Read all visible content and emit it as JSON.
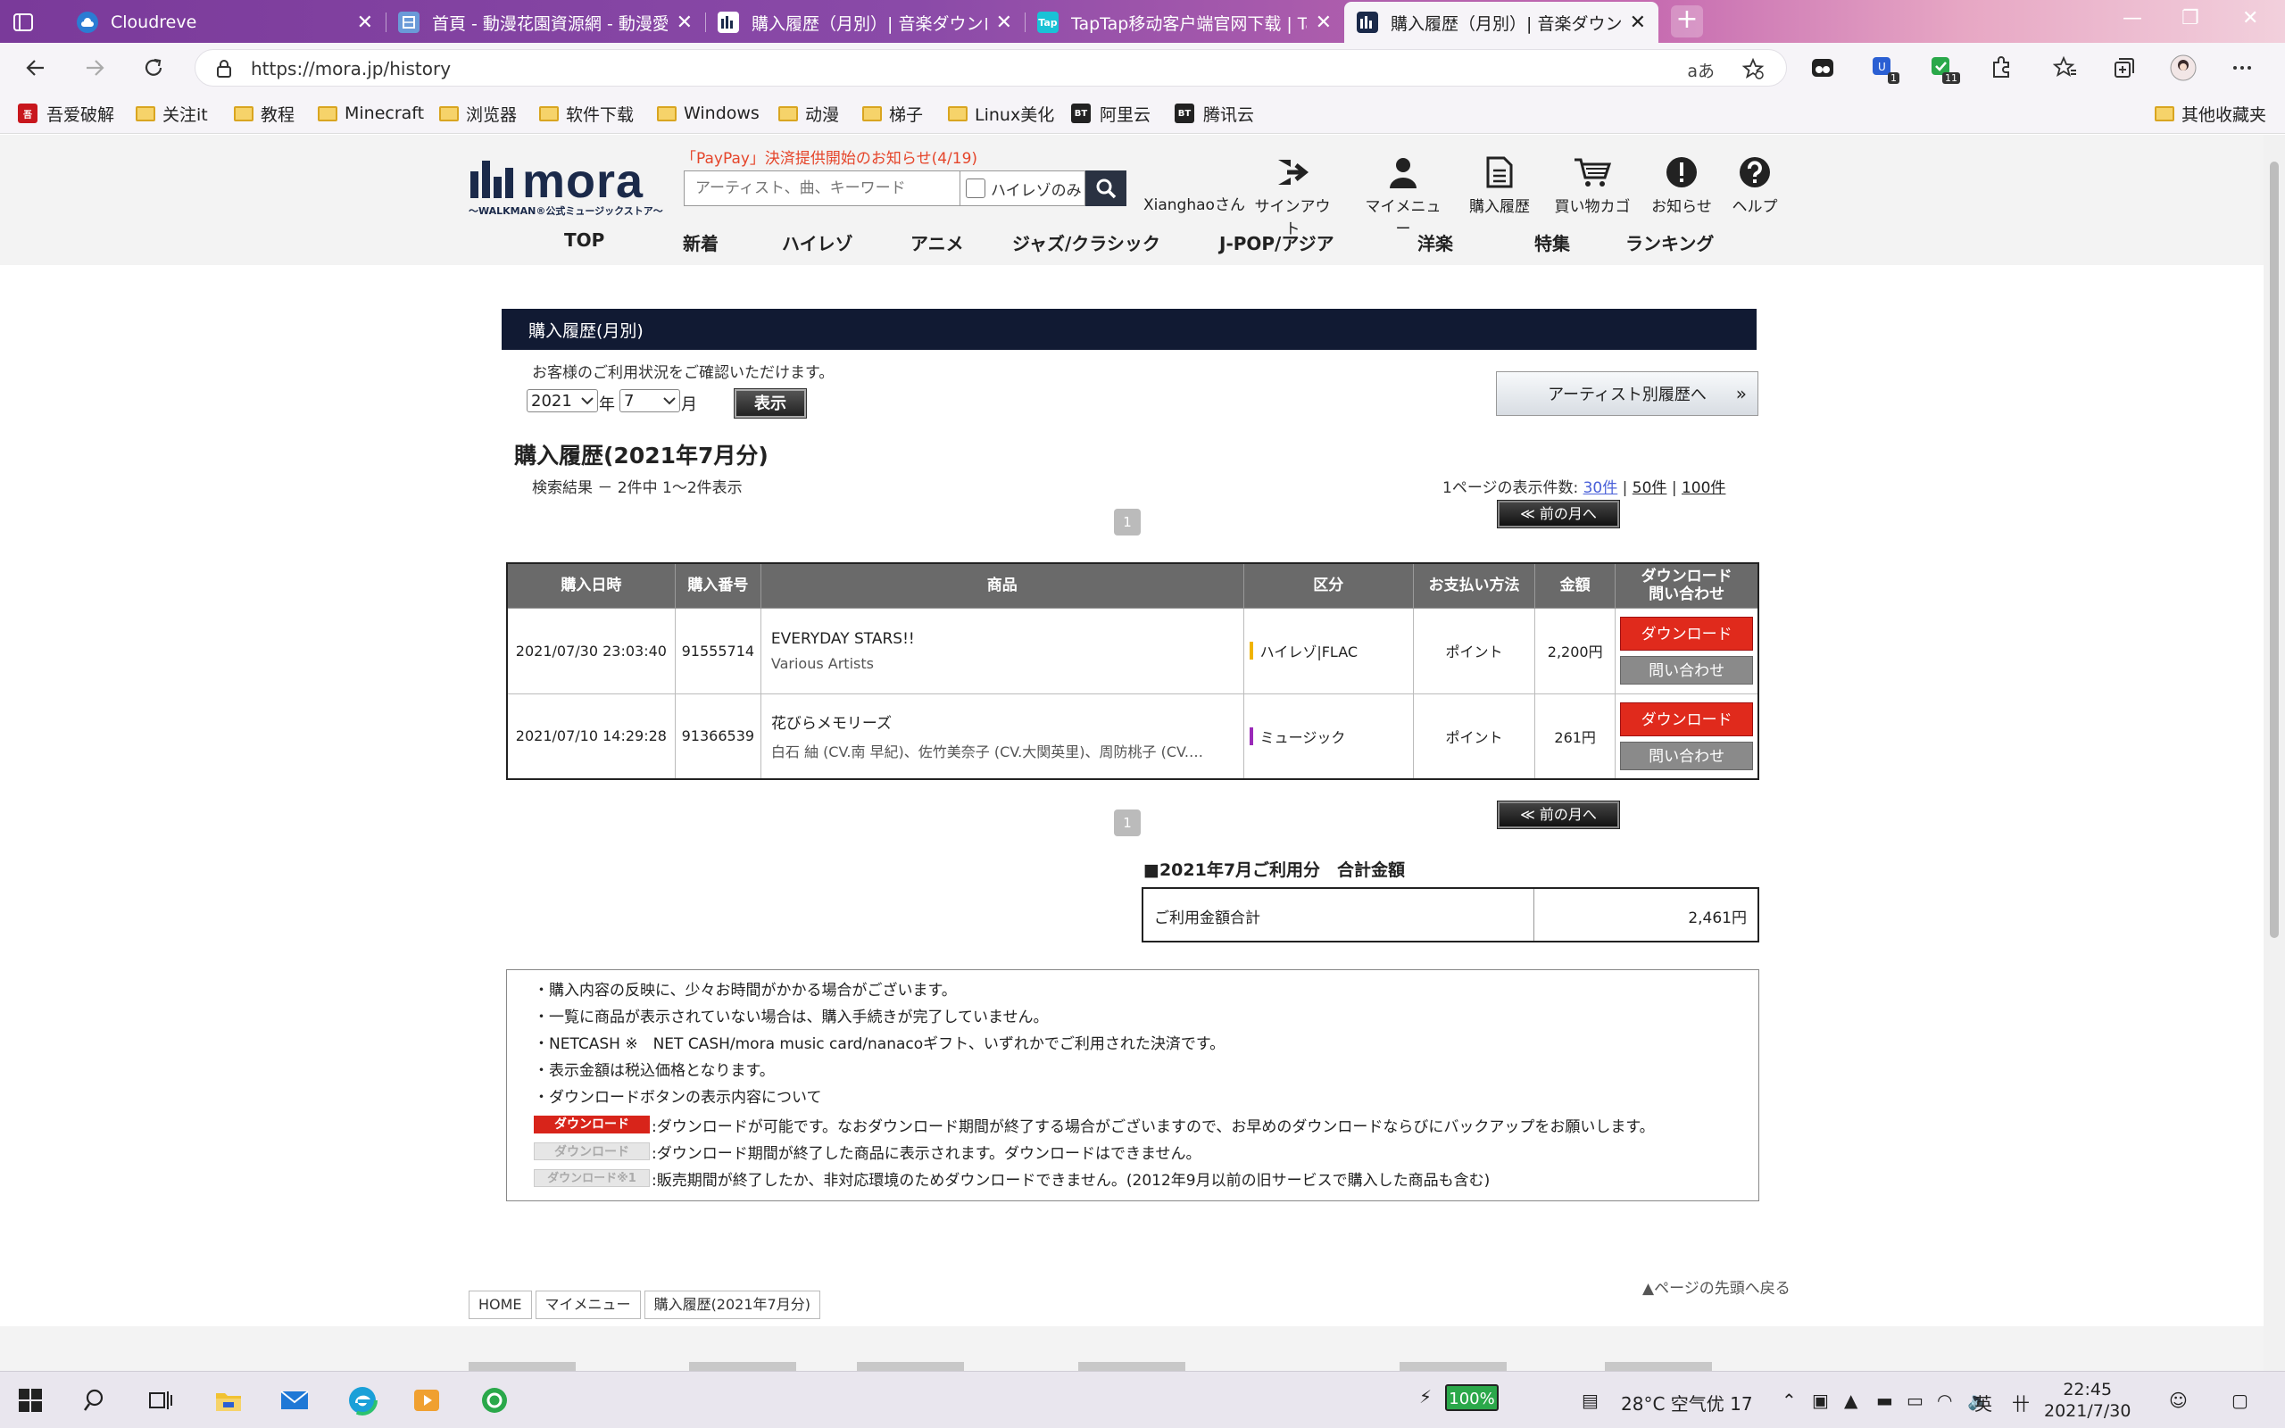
{
  "browser": {
    "tabs": [
      {
        "label": "Cloudreve",
        "icon": "cloud-icon",
        "color": "#2b7cd3"
      },
      {
        "label": "首頁 - 動漫花園資源網 - 動漫愛",
        "icon": "dmhy-icon",
        "color": "#6a9ad8"
      },
      {
        "label": "購入履歴（月別）| 音楽ダウンロ",
        "icon": "mora-icon",
        "color": "#1b2a4a"
      },
      {
        "label": "TapTap移动客户端官网下载 | Tap",
        "icon": "taptap-icon",
        "color": "#19c2d6"
      },
      {
        "label": "購入履歴（月別）| 音楽ダウンロ",
        "icon": "mora-icon",
        "color": "#1b2a4a"
      }
    ],
    "new_tab": "+",
    "url": "https://mora.jp/history",
    "read_aloud": "aあ",
    "ext_badges": {
      "b1": "1",
      "b2": "11"
    },
    "bookmarks": [
      {
        "label": "吾爱破解",
        "type": "logo",
        "color": "#c8161d"
      },
      {
        "label": "关注it",
        "type": "folder"
      },
      {
        "label": "教程",
        "type": "folder"
      },
      {
        "label": "Minecraft",
        "type": "folder"
      },
      {
        "label": "浏览器",
        "type": "folder"
      },
      {
        "label": "软件下载",
        "type": "folder"
      },
      {
        "label": "Windows",
        "type": "folder"
      },
      {
        "label": "动漫",
        "type": "folder"
      },
      {
        "label": "梯子",
        "type": "folder"
      },
      {
        "label": "Linux美化",
        "type": "folder"
      },
      {
        "label": "阿里云",
        "type": "logo",
        "color": "#222222"
      },
      {
        "label": "腾讯云",
        "type": "logo",
        "color": "#222222"
      }
    ],
    "bookmark_logo_text": "BT",
    "other_bookmarks": "其他收藏夹"
  },
  "site": {
    "logo": "mora",
    "logo_sub": "〜WALKMAN®公式ミュージックストア〜",
    "notice": "「PayPay」決済提供開始のお知らせ(4/19)",
    "search_placeholder": "アーティスト、曲、キーワード",
    "hires_only": "ハイレゾのみ",
    "username": "Xianghaoさん",
    "header_nav": [
      "サインアウト",
      "マイメニュー",
      "購入履歴",
      "買い物カゴ",
      "お知らせ",
      "ヘルプ"
    ],
    "categories": [
      "TOP",
      "新着",
      "ハイレゾ",
      "アニメ",
      "ジャズ/クラシック",
      "J-POP/アジア",
      "洋楽",
      "特集",
      "ランキング"
    ]
  },
  "history": {
    "title_bar": "購入履歴(月別)",
    "intro": "お客様のご利用状況をご確認いただけます。",
    "year": "2021",
    "year_suffix": "年",
    "month": "7",
    "month_suffix": "月",
    "show_button": "表示",
    "artist_button": "アーティスト別履歴へ",
    "section_title": "購入履歴(2021年7月分)",
    "result_count": "検索結果 － 2件中 1〜2件表示",
    "per_page_label": "1ページの表示件数:",
    "per_page_options": [
      "30件",
      "50件",
      "100件"
    ],
    "page_number": "1",
    "prev_month": "≪ 前の月へ",
    "columns": [
      "購入日時",
      "購入番号",
      "商品",
      "区分",
      "お支払い方法",
      "金額",
      "ダウンロード問い合わせ"
    ],
    "rows": [
      {
        "date": "2021/07/30 23:03:40",
        "number": "91555714",
        "title": "EVERYDAY STARS!!",
        "artist": "Various Artists",
        "kubun": "ハイレゾ|FLAC",
        "kubun_color": "#f0b400",
        "payment": "ポイント",
        "price": "2,200円",
        "download": "ダウンロード",
        "inquiry": "問い合わせ"
      },
      {
        "date": "2021/07/10 14:29:28",
        "number": "91366539",
        "title": "花びらメモリーズ",
        "artist": "白石 紬 (CV.南 早紀)、佐竹美奈子 (CV.大関英里)、周防桃子 (CV.…",
        "kubun": "ミュージック",
        "kubun_color": "#9a2ab8",
        "payment": "ポイント",
        "price": "261円",
        "download": "ダウンロード",
        "inquiry": "問い合わせ"
      }
    ],
    "total_title": "■2021年7月ご利用分　合計金額",
    "total_label": "ご利用金額合計",
    "total_value": "2,461円",
    "notes": [
      "・購入内容の反映に、少々お時間がかかる場合がございます。",
      "・一覧に商品が表示されていない場合は、購入手続きが完了していません。",
      "・NETCASH ※　NET CASH/mora music card/nanacoギフト、いずれかでご利用された決済です。",
      "・表示金額は税込価格となります。",
      "・ダウンロードボタンの表示内容について"
    ],
    "legend": [
      {
        "badge": "ダウンロード",
        "text": ":ダウンロードが可能です。なおダウンロード期間が終了する場合がございますので、お早めのダウンロードならびにバックアップをお願いします。"
      },
      {
        "badge": "ダウンロード",
        "text": ":ダウンロード期間が終了した商品に表示されます。ダウンロードはできません。"
      },
      {
        "badge": "ダウンロード※1",
        "text": ":販売期間が終了したか、非対応環境のためダウンロードできません。(2012年9月以前の旧サービスで購入した商品も含む)"
      }
    ],
    "back_to_top": "▲ページの先頭へ戻る",
    "breadcrumb": [
      "HOME",
      "マイメニュー",
      "購入履歴(2021年7月分)"
    ]
  },
  "taskbar": {
    "battery": "100%",
    "weather": "28°C 空气优 17",
    "ime": "英",
    "time": "22:45",
    "date": "2021/7/30"
  }
}
